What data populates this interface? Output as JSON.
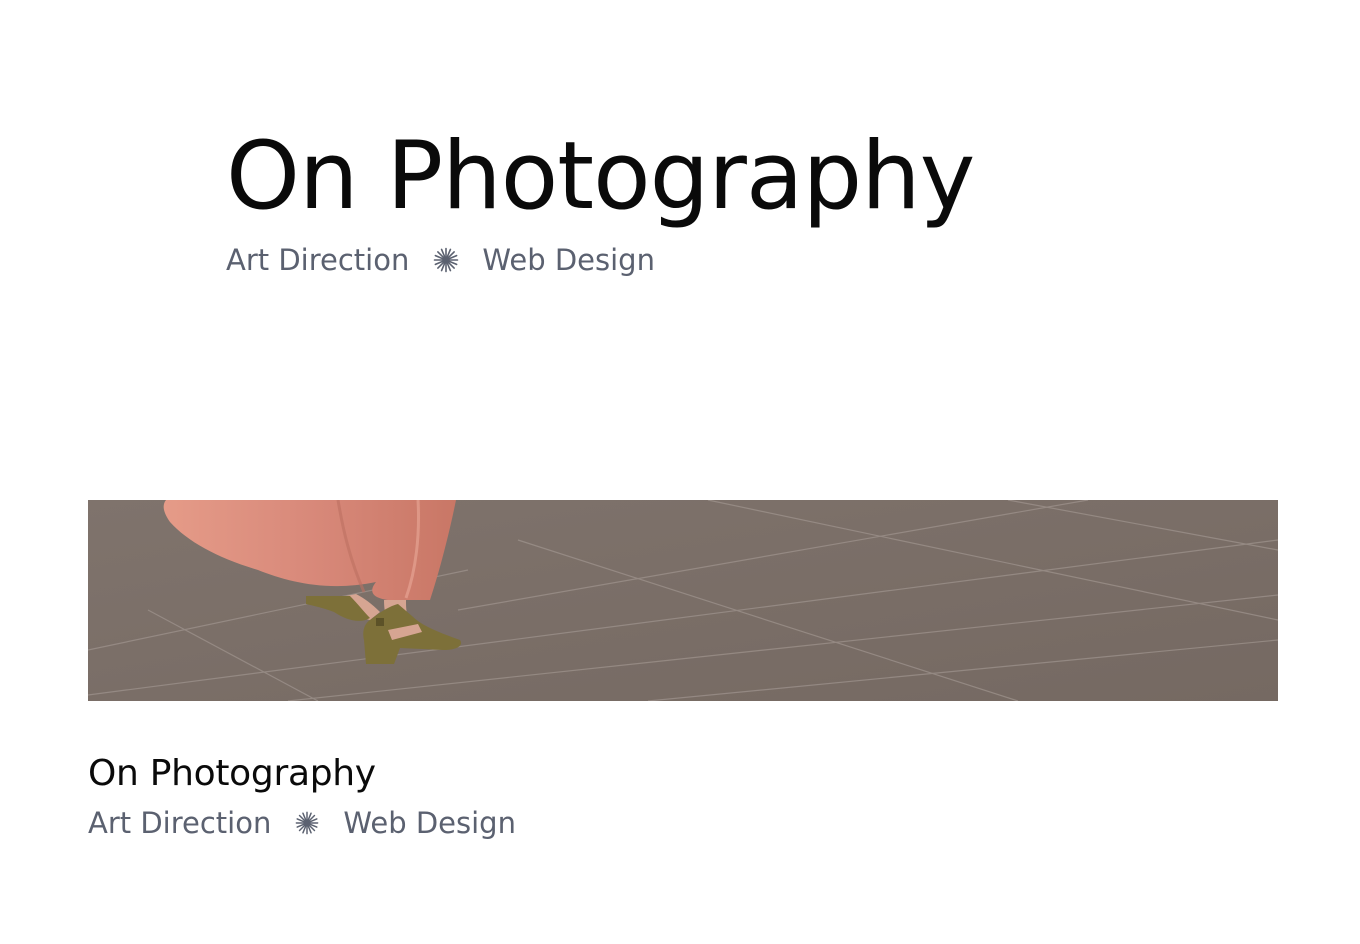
{
  "hero": {
    "title": "On Photography",
    "tags": [
      "Art Direction",
      "Web Design"
    ],
    "separator_icon": "asterisk-burst-icon"
  },
  "card": {
    "image_description_icon": "photo-dress-sandals",
    "title": "On Photography",
    "tags": [
      "Art Direction",
      "Web Design"
    ],
    "separator_icon": "asterisk-burst-icon"
  },
  "colors": {
    "title": "#0a0a0a",
    "meta": "#5b6170",
    "floor": "#7b6f69",
    "dress": "#d88a79",
    "sandal": "#7d7039"
  }
}
